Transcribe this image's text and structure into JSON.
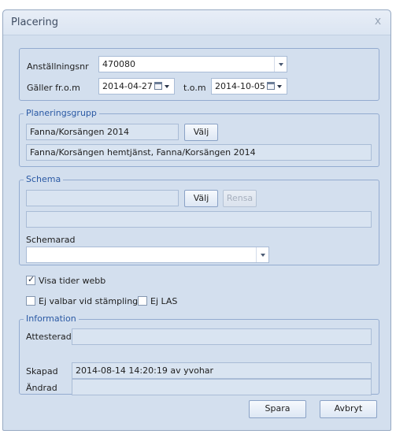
{
  "window": {
    "title": "Placering",
    "close_glyph": "x"
  },
  "employment": {
    "number_label": "Anställningsnr",
    "number_value": "470080",
    "valid_from_label": "Gäller fr.o.m",
    "valid_from_value": "2014-04-27",
    "to_label": "t.o.m",
    "to_value": "2014-10-05"
  },
  "planning_group": {
    "legend": "Planeringsgrupp",
    "name_value": "Fanna/Korsängen 2014",
    "choose_label": "Välj",
    "description_value": "Fanna/Korsängen hemtjänst, Fanna/Korsängen 2014"
  },
  "schedule": {
    "legend": "Schema",
    "name_value": "",
    "choose_label": "Välj",
    "clear_label": "Rensa",
    "description_value": "",
    "schemarad_label": "Schemarad",
    "schemarad_value": ""
  },
  "options": {
    "show_times_web_label": "Visa tider webb",
    "show_times_web_checked": true,
    "not_selectable_label": "Ej valbar vid stämpling",
    "not_selectable_checked": false,
    "no_las_label": "Ej LAS",
    "no_las_checked": false,
    "check_glyph": "✓"
  },
  "information": {
    "legend": "Information",
    "attested_label": "Attesterad",
    "attested_value": "",
    "created_label": "Skapad",
    "created_value": "2014-08-14 14:20:19 av yvohar",
    "changed_label": "Ändrad",
    "changed_value": ""
  },
  "footer": {
    "save_label": "Spara",
    "cancel_label": "Avbryt"
  }
}
